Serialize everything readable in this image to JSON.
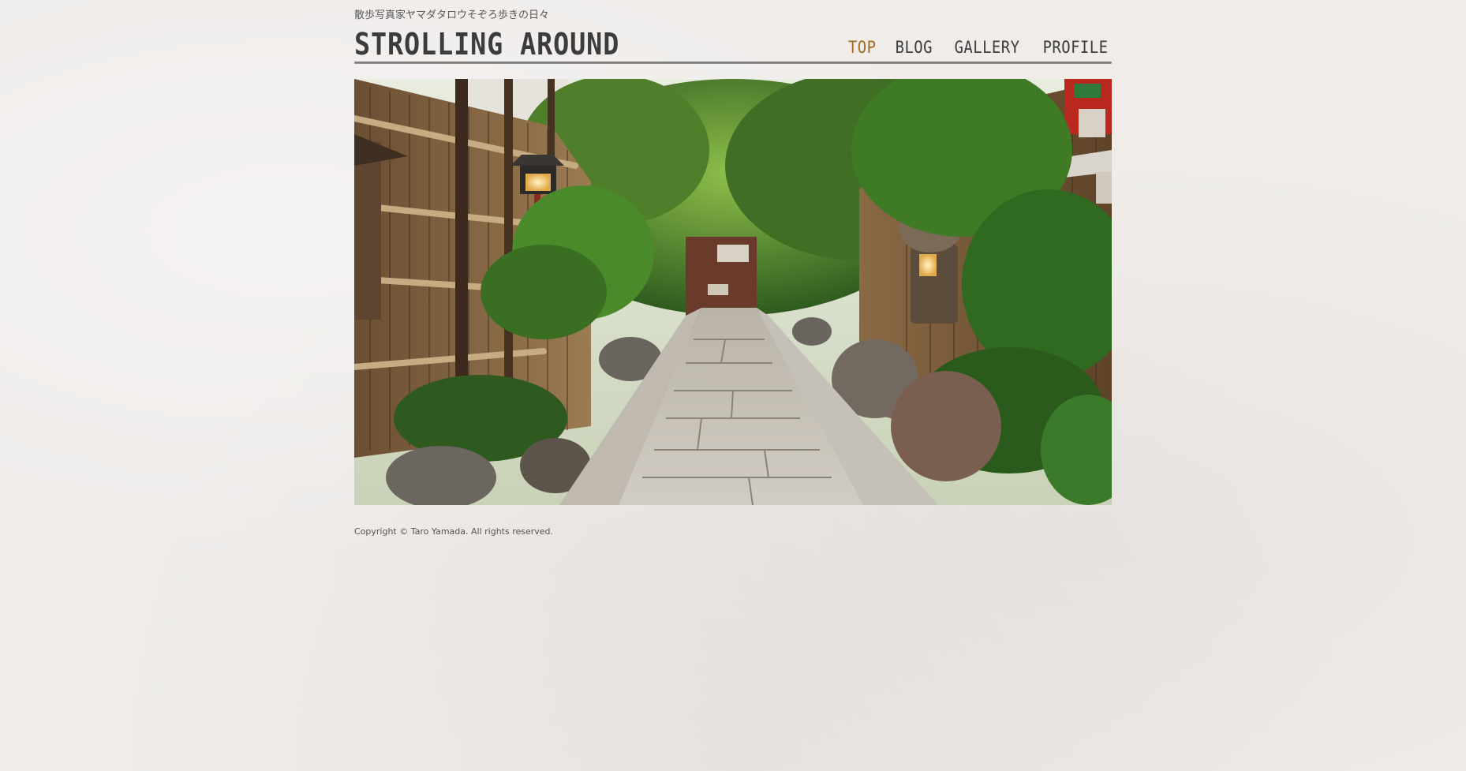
{
  "header": {
    "tagline": "散歩写真家ヤマダタロウそぞろ歩きの日々",
    "logo": "STROLLING AROUND"
  },
  "nav": {
    "items": [
      {
        "label": "TOP",
        "active": true
      },
      {
        "label": "BLOG",
        "active": false
      },
      {
        "label": "GALLERY",
        "active": false
      },
      {
        "label": "PROFILE",
        "active": false
      }
    ]
  },
  "hero": {
    "alt": "Stone path through a Japanese garden lined with bamboo fences and lanterns"
  },
  "footer": {
    "copyright": "Copyright © Taro Yamada. All rights reserved."
  },
  "colors": {
    "background": "#efecea",
    "text": "#3c3c3c",
    "nav_active": "#a66a1a"
  }
}
